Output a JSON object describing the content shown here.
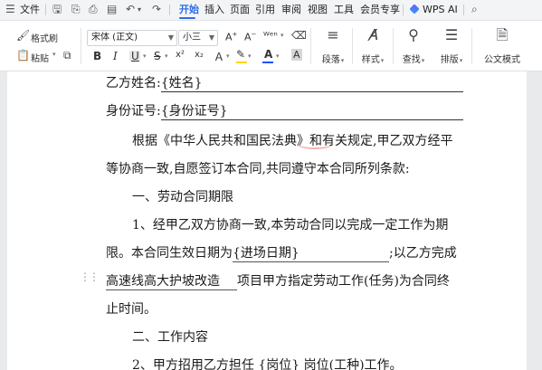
{
  "menubar": {
    "hamburger_icon": "hamburger-icon",
    "file_label": "文件",
    "tabs": [
      "开始",
      "插入",
      "页面",
      "引用",
      "审阅",
      "视图",
      "工具",
      "会员专享"
    ],
    "active_tab": "开始",
    "ai_label": "WPS AI",
    "search_icon": "search-icon"
  },
  "ribbon": {
    "format_painter": "格式刷",
    "paste": "粘贴",
    "font_name": "宋体 (正文)",
    "font_size": "小三",
    "bold": "B",
    "italic": "I",
    "underline": "U",
    "strikethrough": "S",
    "paragraph": "段落",
    "styles": "样式",
    "find": "查找",
    "layout": "排版",
    "official_doc": "公文模式",
    "accent_color": "#2f6ee6",
    "font_color": "#1f4fff",
    "highlight_color": "#ffd400"
  },
  "document": {
    "party_b_name_label": "乙方姓名:",
    "party_b_name_field": "{姓名}",
    "id_label": "身份证号:",
    "id_field": "{身份证号}",
    "para1_line1": "根据《中华人民共和国民法典》和有关规定,甲乙双方经平",
    "para1_line2": "等协商一致,自愿签订本合同,共同遵守本合同所列条款:",
    "section1_title": "一、劳动合同期限",
    "clause1_line1": "1、经甲乙双方协商一致,本劳动合同以完成一定工作为期",
    "clause1_line2_a": "限。本合同生效日期为",
    "clause1_date_field": "{进场日期}",
    "clause1_line2_b": ";以乙方完成",
    "clause1_project": "高速线高大护坡改造",
    "clause1_line3_b": "项目甲方指定劳动工作(任务)为合同终",
    "clause1_line4": "止时间。",
    "section2_title": "二、工作内容",
    "clause2_partial": "2、甲方招用乙方担任 {岗位}  岗位(工种)工作。"
  }
}
